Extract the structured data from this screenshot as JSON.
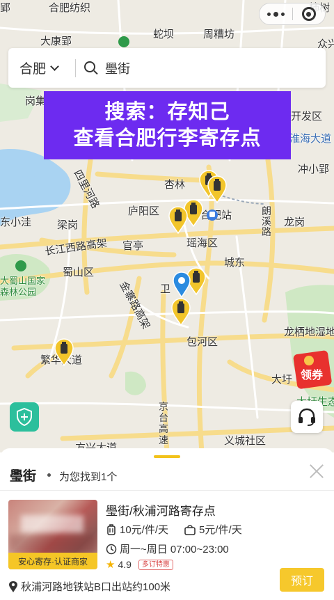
{
  "capsule": {
    "more_icon": "more-dots-icon",
    "close_icon": "target-icon"
  },
  "search": {
    "city": "合肥",
    "query": "璺街"
  },
  "banner": {
    "line1": "搜索：存知己",
    "line2": "查看合肥行李寄存点"
  },
  "map_labels": {
    "l1": "合肥纺织",
    "l2": "柿树",
    "l3": "郢",
    "l4": "大康郢",
    "l5": "蛇坝",
    "l6": "周糟坊",
    "l7": "众兴",
    "l8": "岗集",
    "l9": "开发区",
    "l10": "淮海大道",
    "l11": "冲小郢",
    "l12": "杏林",
    "l13": "庐阳区",
    "l14": "合肥站",
    "l15": "朗溪路",
    "l16": "龙岗",
    "l17": "东小洼",
    "l18": "梁岗",
    "l19": "长江西路高架",
    "l20": "官亭",
    "l21": "瑶海区",
    "l22": "蜀山区",
    "l23": "城东",
    "l24": "大蜀山国家森林公园",
    "l25": "卫",
    "l26": "金寨路高架",
    "l27": "包河区",
    "l28": "龙栖地湿地",
    "l29": "繁华大道",
    "l30": "大圩",
    "l31": "大圩生态",
    "l32": "京台高速",
    "l33": "方兴大道",
    "l34": "义城社区",
    "l35": "四里河路"
  },
  "coupon": {
    "label": "领券"
  },
  "sheet": {
    "title": "璺街",
    "subtitle": "为您找到1个"
  },
  "store": {
    "name": "璺街/秋浦河路寄存点",
    "price_small": "10元/件/天",
    "price_large": "5元/件/天",
    "hours": "周一~周日 07:00~23:00",
    "rating": "4.9",
    "badge": "多订特惠",
    "image_tag": "安心寄存·认证商家",
    "address": "秋浦河路地铁站B口出站约100米",
    "book_label": "预订"
  },
  "colors": {
    "accent": "#f6c82c",
    "banner": "#6d2bf0",
    "shield": "#2cbf9c"
  }
}
